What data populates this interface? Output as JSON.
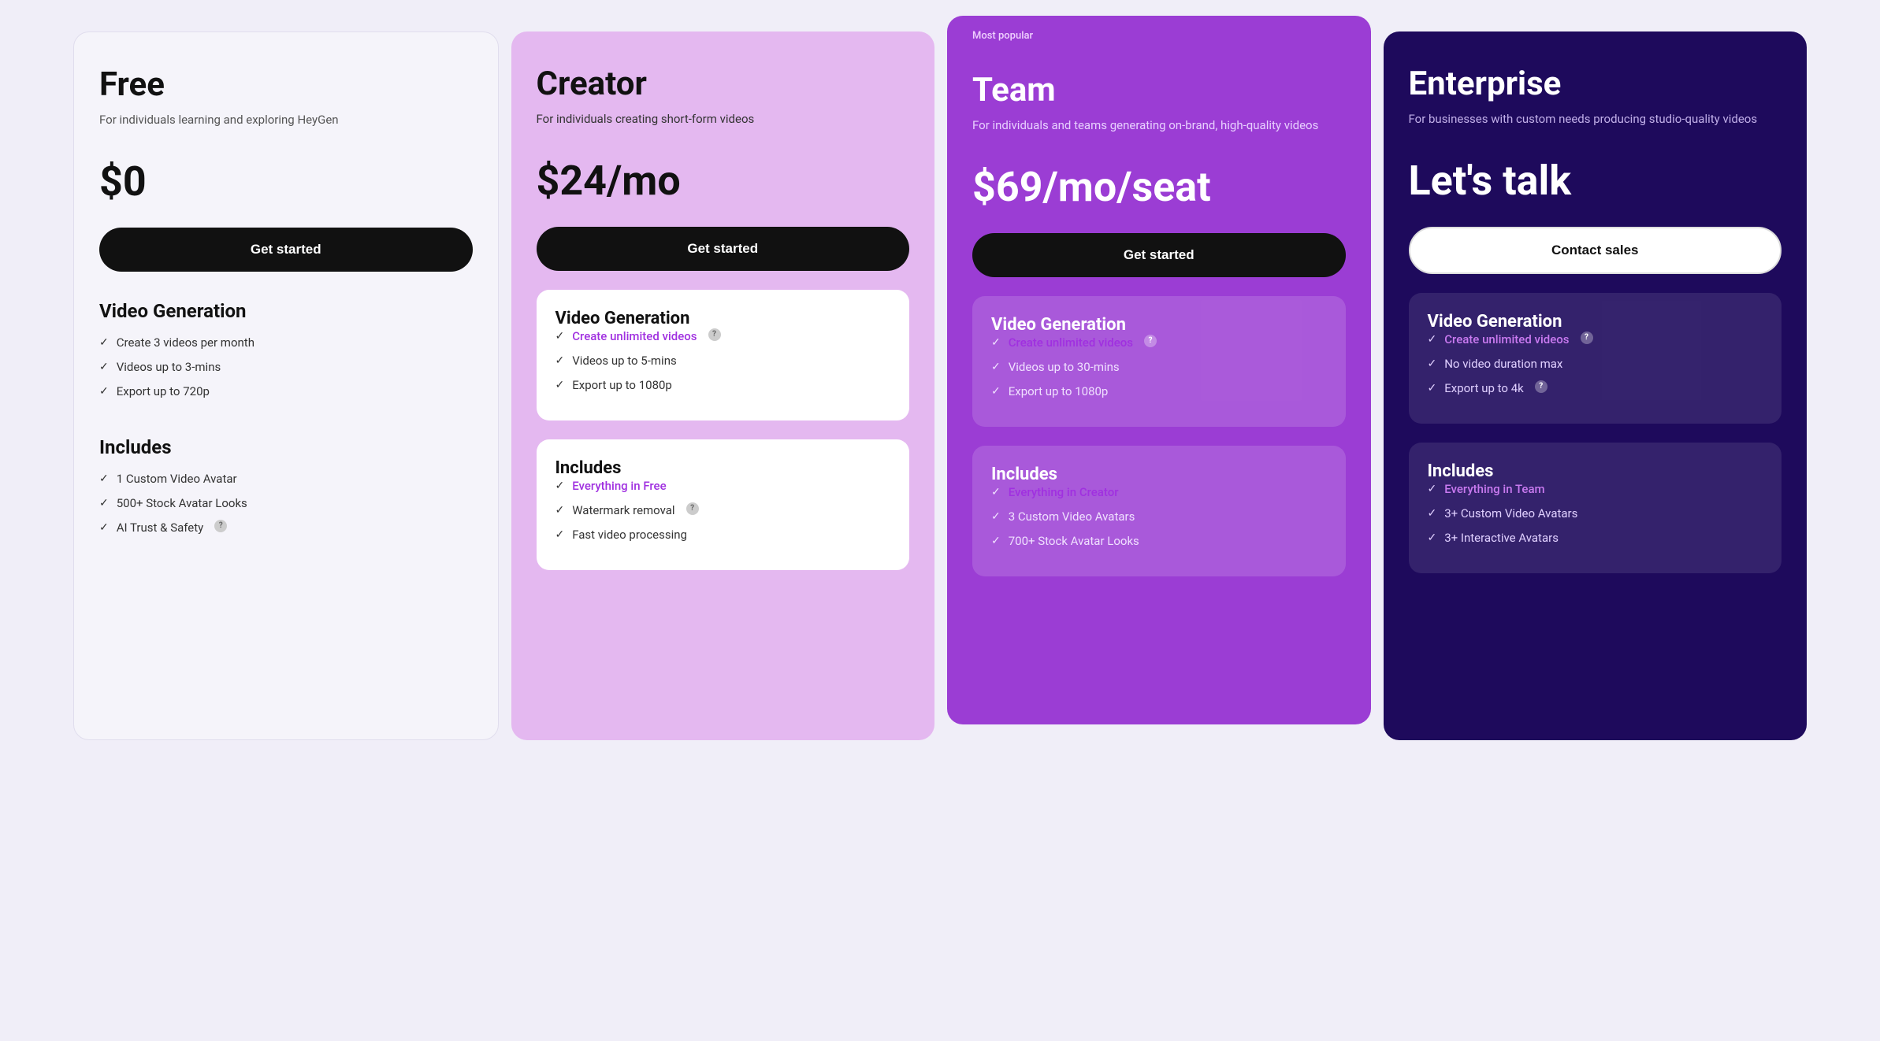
{
  "plans": [
    {
      "id": "free",
      "name": "Free",
      "desc": "For individuals learning and exploring HeyGen",
      "price": "$0",
      "cta": "Get started",
      "cta_style": "dark",
      "most_popular": false,
      "video_gen_title": "Video Generation",
      "video_gen_features": [
        {
          "text": "Create 3 videos per month",
          "link": false
        },
        {
          "text": "Videos up to 3-mins",
          "link": false
        },
        {
          "text": "Export up to 720p",
          "link": false
        }
      ],
      "includes_title": "Includes",
      "includes_features": [
        {
          "text": "1 Custom Video Avatar",
          "link": false
        },
        {
          "text": "500+ Stock Avatar Looks",
          "link": false
        },
        {
          "text": "AI Trust & Safety",
          "link": false,
          "info": true
        }
      ]
    },
    {
      "id": "creator",
      "name": "Creator",
      "desc": "For individuals creating short-form videos",
      "price": "$24/mo",
      "cta": "Get started",
      "cta_style": "dark",
      "most_popular": false,
      "video_gen_title": "Video Generation",
      "video_gen_features": [
        {
          "text": "Create unlimited videos",
          "link": true,
          "info": true
        },
        {
          "text": "Videos up to 5-mins",
          "link": false
        },
        {
          "text": "Export up to 1080p",
          "link": false
        }
      ],
      "includes_title": "Includes",
      "includes_features": [
        {
          "text": "Everything in Free",
          "link": true
        },
        {
          "text": "Watermark removal",
          "link": false,
          "info": true
        },
        {
          "text": "Fast video processing",
          "link": false
        }
      ]
    },
    {
      "id": "team",
      "name": "Team",
      "desc": "For individuals and teams generating on-brand, high-quality videos",
      "price": "$69/mo/seat",
      "cta": "Get started",
      "cta_style": "dark",
      "most_popular": true,
      "most_popular_label": "Most popular",
      "video_gen_title": "Video Generation",
      "video_gen_features": [
        {
          "text": "Create unlimited videos",
          "link": true,
          "info": true
        },
        {
          "text": "Videos up to 30-mins",
          "link": false
        },
        {
          "text": "Export up to 1080p",
          "link": false
        }
      ],
      "includes_title": "Includes",
      "includes_features": [
        {
          "text": "Everything in Creator",
          "link": true
        },
        {
          "text": "3 Custom Video Avatars",
          "link": false
        },
        {
          "text": "700+ Stock Avatar Looks",
          "link": false
        }
      ]
    },
    {
      "id": "enterprise",
      "name": "Enterprise",
      "desc": "For businesses with custom needs producing studio-quality videos",
      "price": "Let's talk",
      "cta": "Contact sales",
      "cta_style": "outline",
      "most_popular": false,
      "video_gen_title": "Video Generation",
      "video_gen_features": [
        {
          "text": "Create unlimited videos",
          "link": true,
          "info": true
        },
        {
          "text": "No video duration max",
          "link": false
        },
        {
          "text": "Export up to 4k",
          "link": false,
          "info": true
        }
      ],
      "includes_title": "Includes",
      "includes_features": [
        {
          "text": "Everything in Team",
          "link": true
        },
        {
          "text": "3+ Custom Video Avatars",
          "link": false
        },
        {
          "text": "3+ Interactive Avatars",
          "link": false
        }
      ]
    }
  ]
}
